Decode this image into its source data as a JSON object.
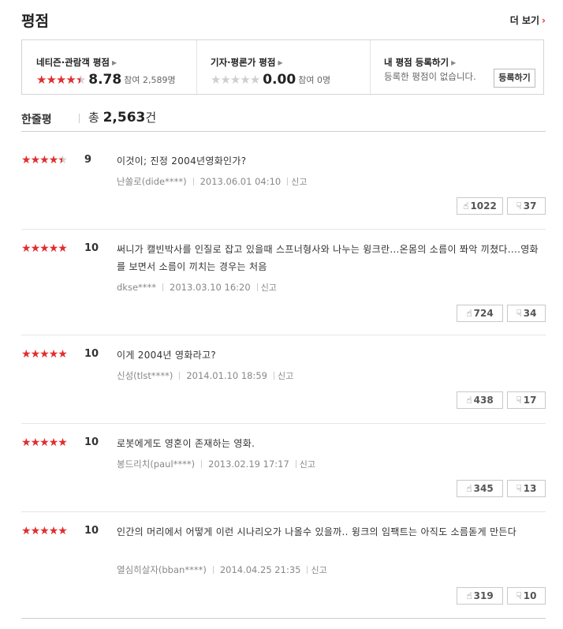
{
  "header": {
    "title": "평점",
    "more_label": "더 보기",
    "more_arrow": "›"
  },
  "summary": {
    "netizen": {
      "label": "네티즌·관람객 평점",
      "rating_out_of_5": 4.5,
      "score": "8.78",
      "participants": "참여 2,589명"
    },
    "critic": {
      "label": "기자·평론가 평점",
      "rating_out_of_5": 0,
      "score": "0.00",
      "participants": "참여 0명"
    },
    "mine": {
      "label": "내 평점 등록하기",
      "message": "등록한 평점이 없습니다.",
      "button_label": "등록하기"
    }
  },
  "count_bar": {
    "label": "한줄평",
    "total_prefix": "총",
    "total_count": "2,563",
    "total_suffix": "건"
  },
  "reviews": [
    {
      "stars": 4.5,
      "score": "9",
      "text": "이것이; 진정 2004년영화인가?",
      "user": "난쏠로(dide****)",
      "date": "2013.06.01 04:10",
      "report": "신고",
      "likes": "1022",
      "dislikes": "37"
    },
    {
      "stars": 5,
      "score": "10",
      "text": "써니가 캘빈박사를 인질로 잡고 있을때 스프너형사와 나누는 윙크란...온몸의 소름이 쫘악 끼쳤다....영화를 보면서 소름이 끼치는 경우는 처음",
      "user": "dkse****",
      "date": "2013.03.10 16:20",
      "report": "신고",
      "likes": "724",
      "dislikes": "34"
    },
    {
      "stars": 5,
      "score": "10",
      "text": "이게 2004년 영화라고?",
      "user": "신성(tlst****)",
      "date": "2014.01.10 18:59",
      "report": "신고",
      "likes": "438",
      "dislikes": "17"
    },
    {
      "stars": 5,
      "score": "10",
      "text": "로봇에게도 영혼이 존재하는 영화.",
      "user": "봉드리치(paul****)",
      "date": "2013.02.19 17:17",
      "report": "신고",
      "likes": "345",
      "dislikes": "13"
    },
    {
      "stars": 5,
      "score": "10",
      "text": "인간의 머리에서 어떻게 이런 시나리오가 나올수 있을까.. 윙크의 임팩트는 아직도 소름돋게 만든다",
      "user": "열심히살자(bban****)",
      "date": "2014.04.25 21:35",
      "report": "신고",
      "likes": "319",
      "dislikes": "10"
    }
  ],
  "icons": {
    "star": "star-icon",
    "thumbs_up": "thumbs-up-icon",
    "thumbs_down": "thumbs-down-icon",
    "chevron_right": "chevron-right-icon"
  },
  "colors": {
    "accent_red": "#e02e2e",
    "star_gray": "#cfcfcf"
  }
}
